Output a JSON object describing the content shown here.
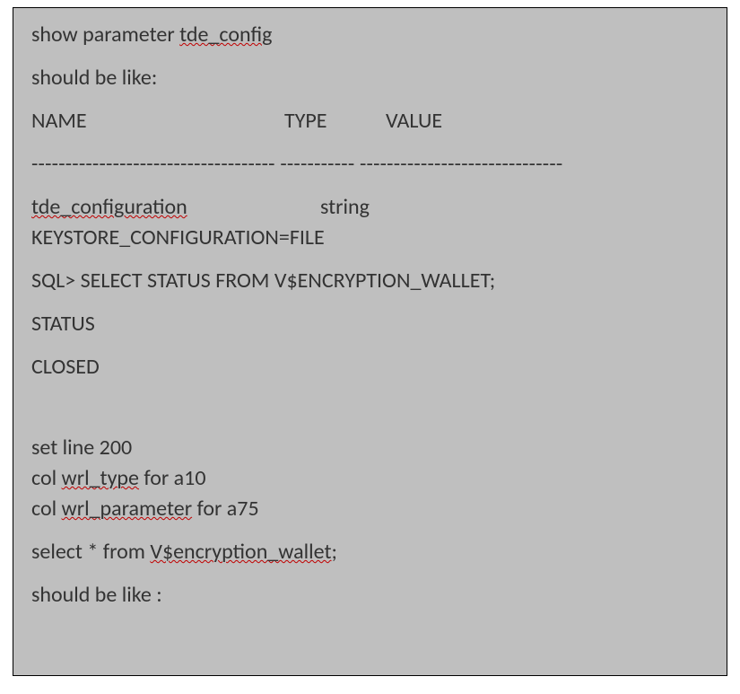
{
  "lines": {
    "l1_pre": "show parameter ",
    "l1_err": "tde_config",
    "l2": "should be like:",
    "header": {
      "name": "NAME",
      "type": "TYPE",
      "value": "VALUE"
    },
    "sep": "------------------------------------ ----------- ------------------------------",
    "param_name": "tde_configuration",
    "param_type": "string",
    "param_value": "KEYSTORE_CONFIGURATION=FILE",
    "sql1": "SQL> SELECT STATUS FROM V$ENCRYPTION_WALLET;",
    "status_label": "STATUS",
    "status_value": "CLOSED",
    "set_line": "set line 200",
    "col1_pre": "col ",
    "col1_err": "wrl_type",
    "col1_post": " for a10",
    "col2_pre": "col ",
    "col2_err": "wrl_parameter",
    "col2_post": " for a75",
    "sel_pre": "select * from ",
    "sel_err": "V$encryption_wallet",
    "sel_post": ";",
    "last": "should be like :"
  }
}
